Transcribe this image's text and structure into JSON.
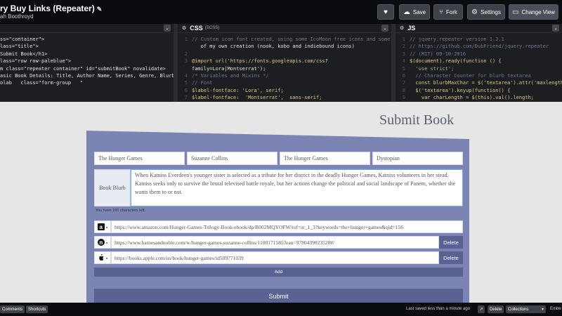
{
  "topbar": {
    "title": "ry Buy Links (Repeater)",
    "author": "ah Boothroyd",
    "buttons": {
      "heart_icon": "heart-icon",
      "save": "Save",
      "fork": "Fork",
      "settings": "Settings",
      "change_view": "Change View"
    }
  },
  "editors": {
    "html": {
      "lines": [
        "ss=\"container\">",
        "lass=\"title\">",
        "Submit Book</h1>",
        "",
        "lass=\"row row-paleblue\">",
        "m class=\"repeater container\" id=\"submitBook\" novalidate>",
        "asic Book Details: Title, Author Name, Series, Genre, Blurb",
        "",
        "olab   class=\"form-group   \""
      ]
    },
    "css": {
      "label": "CSS",
      "sub_label": "(SCSS)",
      "lines": [
        "// Custom icon font created, using some IcoMoon free icons and some",
        "   of my own creation (nook, kobo and indiebound icons)",
        "",
        "@import url('https://fonts.googleapis.com/css?",
        "family=Lora|Montserrat');",
        "/* Variables and Mixins */",
        "// Font",
        "$label-fontface: 'Lora', serif;",
        "$label-fontface:  'Montserrat',  sans-serif;"
      ],
      "line_numbers": [
        "1",
        "",
        "2",
        "3",
        "",
        "4",
        "5",
        "6",
        "7"
      ]
    },
    "js": {
      "label": "JS",
      "lines": [
        "// jquery.repeater version 1.2.1",
        "// https://github.com/DubFriend/jquery.repeater",
        "// (MIT) 09-10-2016",
        "$(document).ready(function () {",
        "  'use strict';",
        "  // Character Counter for blurb textarea",
        "  const blurbMaxChar = $('textarea').attr('maxlength');",
        "  $('textarea').keyup(function() {",
        "    var charLength = $(this).val().length;"
      ],
      "line_numbers": [
        "1",
        "2",
        "3",
        "4",
        "5",
        "6",
        "7",
        "8",
        "9"
      ]
    }
  },
  "preview": {
    "page_title": "Submit Book",
    "fields": {
      "title": "The Hunger Games",
      "author": "Suzanne Collins",
      "series": "The Hunger Games",
      "genre": "Dystopian"
    },
    "blurb_label": "Book Blurb",
    "blurb_text": "When Katniss Everdeen's younger sister is selected as a tribute for her district in the deadly Hunger Games, Katniss volunteers in her stead. Katniss seeks only to survive the brutal televised battle royale, but her actions change the political and social landscape of Panem, whether she wants them to or not.",
    "chars_left": "You have 191 characters left.",
    "links": [
      {
        "icon": "amazon-icon",
        "glyph": "a",
        "url": "https://www.amazon.com/Hunger-Games-Trilogy-Book-ebook/dp/B002MQYOFW/ref=sr_1_3?keywords=the+hunger+games&qid=156"
      },
      {
        "icon": "nook-icon",
        "glyph": "n",
        "url": "https://www.barnesandnoble.com/w/hunger-games-suzanne-collins/1100171585?ean=9780439023528#/",
        "delete": "Delete"
      },
      {
        "icon": "apple-icon",
        "glyph": "",
        "url": "https://books.apple.com/us/book/hunger-games/id509771039",
        "delete": "Delete"
      }
    ],
    "add_label": "Add",
    "submit_label": "Submit"
  },
  "bottombar": {
    "comments": "Comments",
    "shortcuts": "Shortcuts",
    "last_saved": "Last saved less than a minute ago",
    "delete": "Delete",
    "collections": "Collections",
    "embed": "Embe"
  },
  "colors": {
    "chrome": "#0b0c10",
    "editor_bg": "#1d1e22",
    "card": "#7b84b2",
    "button": "#5a6293",
    "page_bg": "#e6e6e6",
    "title_text": "#5c6170"
  }
}
